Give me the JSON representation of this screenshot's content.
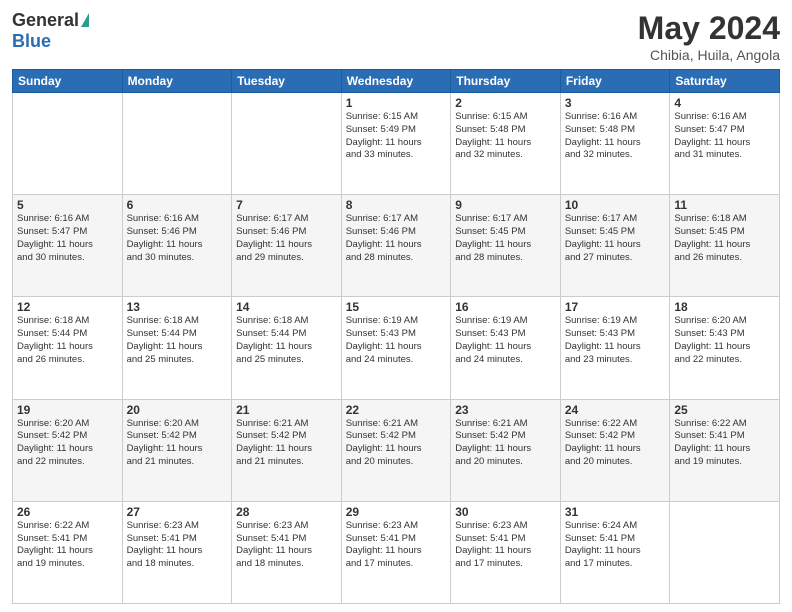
{
  "logo": {
    "general": "General",
    "blue": "Blue"
  },
  "header": {
    "month": "May 2024",
    "location": "Chibia, Huila, Angola"
  },
  "weekdays": [
    "Sunday",
    "Monday",
    "Tuesday",
    "Wednesday",
    "Thursday",
    "Friday",
    "Saturday"
  ],
  "weeks": [
    [
      {
        "day": "",
        "info": ""
      },
      {
        "day": "",
        "info": ""
      },
      {
        "day": "",
        "info": ""
      },
      {
        "day": "1",
        "info": "Sunrise: 6:15 AM\nSunset: 5:49 PM\nDaylight: 11 hours\nand 33 minutes."
      },
      {
        "day": "2",
        "info": "Sunrise: 6:15 AM\nSunset: 5:48 PM\nDaylight: 11 hours\nand 32 minutes."
      },
      {
        "day": "3",
        "info": "Sunrise: 6:16 AM\nSunset: 5:48 PM\nDaylight: 11 hours\nand 32 minutes."
      },
      {
        "day": "4",
        "info": "Sunrise: 6:16 AM\nSunset: 5:47 PM\nDaylight: 11 hours\nand 31 minutes."
      }
    ],
    [
      {
        "day": "5",
        "info": "Sunrise: 6:16 AM\nSunset: 5:47 PM\nDaylight: 11 hours\nand 30 minutes."
      },
      {
        "day": "6",
        "info": "Sunrise: 6:16 AM\nSunset: 5:46 PM\nDaylight: 11 hours\nand 30 minutes."
      },
      {
        "day": "7",
        "info": "Sunrise: 6:17 AM\nSunset: 5:46 PM\nDaylight: 11 hours\nand 29 minutes."
      },
      {
        "day": "8",
        "info": "Sunrise: 6:17 AM\nSunset: 5:46 PM\nDaylight: 11 hours\nand 28 minutes."
      },
      {
        "day": "9",
        "info": "Sunrise: 6:17 AM\nSunset: 5:45 PM\nDaylight: 11 hours\nand 28 minutes."
      },
      {
        "day": "10",
        "info": "Sunrise: 6:17 AM\nSunset: 5:45 PM\nDaylight: 11 hours\nand 27 minutes."
      },
      {
        "day": "11",
        "info": "Sunrise: 6:18 AM\nSunset: 5:45 PM\nDaylight: 11 hours\nand 26 minutes."
      }
    ],
    [
      {
        "day": "12",
        "info": "Sunrise: 6:18 AM\nSunset: 5:44 PM\nDaylight: 11 hours\nand 26 minutes."
      },
      {
        "day": "13",
        "info": "Sunrise: 6:18 AM\nSunset: 5:44 PM\nDaylight: 11 hours\nand 25 minutes."
      },
      {
        "day": "14",
        "info": "Sunrise: 6:18 AM\nSunset: 5:44 PM\nDaylight: 11 hours\nand 25 minutes."
      },
      {
        "day": "15",
        "info": "Sunrise: 6:19 AM\nSunset: 5:43 PM\nDaylight: 11 hours\nand 24 minutes."
      },
      {
        "day": "16",
        "info": "Sunrise: 6:19 AM\nSunset: 5:43 PM\nDaylight: 11 hours\nand 24 minutes."
      },
      {
        "day": "17",
        "info": "Sunrise: 6:19 AM\nSunset: 5:43 PM\nDaylight: 11 hours\nand 23 minutes."
      },
      {
        "day": "18",
        "info": "Sunrise: 6:20 AM\nSunset: 5:43 PM\nDaylight: 11 hours\nand 22 minutes."
      }
    ],
    [
      {
        "day": "19",
        "info": "Sunrise: 6:20 AM\nSunset: 5:42 PM\nDaylight: 11 hours\nand 22 minutes."
      },
      {
        "day": "20",
        "info": "Sunrise: 6:20 AM\nSunset: 5:42 PM\nDaylight: 11 hours\nand 21 minutes."
      },
      {
        "day": "21",
        "info": "Sunrise: 6:21 AM\nSunset: 5:42 PM\nDaylight: 11 hours\nand 21 minutes."
      },
      {
        "day": "22",
        "info": "Sunrise: 6:21 AM\nSunset: 5:42 PM\nDaylight: 11 hours\nand 20 minutes."
      },
      {
        "day": "23",
        "info": "Sunrise: 6:21 AM\nSunset: 5:42 PM\nDaylight: 11 hours\nand 20 minutes."
      },
      {
        "day": "24",
        "info": "Sunrise: 6:22 AM\nSunset: 5:42 PM\nDaylight: 11 hours\nand 20 minutes."
      },
      {
        "day": "25",
        "info": "Sunrise: 6:22 AM\nSunset: 5:41 PM\nDaylight: 11 hours\nand 19 minutes."
      }
    ],
    [
      {
        "day": "26",
        "info": "Sunrise: 6:22 AM\nSunset: 5:41 PM\nDaylight: 11 hours\nand 19 minutes."
      },
      {
        "day": "27",
        "info": "Sunrise: 6:23 AM\nSunset: 5:41 PM\nDaylight: 11 hours\nand 18 minutes."
      },
      {
        "day": "28",
        "info": "Sunrise: 6:23 AM\nSunset: 5:41 PM\nDaylight: 11 hours\nand 18 minutes."
      },
      {
        "day": "29",
        "info": "Sunrise: 6:23 AM\nSunset: 5:41 PM\nDaylight: 11 hours\nand 17 minutes."
      },
      {
        "day": "30",
        "info": "Sunrise: 6:23 AM\nSunset: 5:41 PM\nDaylight: 11 hours\nand 17 minutes."
      },
      {
        "day": "31",
        "info": "Sunrise: 6:24 AM\nSunset: 5:41 PM\nDaylight: 11 hours\nand 17 minutes."
      },
      {
        "day": "",
        "info": ""
      }
    ]
  ]
}
